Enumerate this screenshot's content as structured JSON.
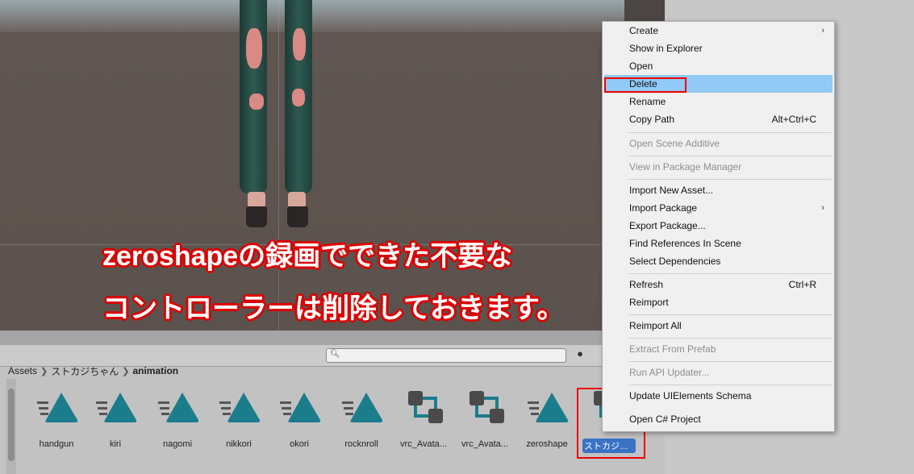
{
  "annotation": {
    "line1": "zeroshapeの録画でできた不要な",
    "line2": "コントローラーは削除しておきます。"
  },
  "breadcrumb": {
    "items": [
      "Assets",
      "ストカジちゃん",
      "animation"
    ]
  },
  "assets": [
    {
      "label": "handgun",
      "type": "anim"
    },
    {
      "label": "kiri",
      "type": "anim"
    },
    {
      "label": "nagomi",
      "type": "anim"
    },
    {
      "label": "nikkori",
      "type": "anim"
    },
    {
      "label": "okori",
      "type": "anim"
    },
    {
      "label": "rocknroll",
      "type": "anim"
    },
    {
      "label": "vrc_Avata...",
      "type": "controller"
    },
    {
      "label": "vrc_Avata...",
      "type": "controller"
    },
    {
      "label": "zeroshape",
      "type": "anim"
    },
    {
      "label": "ストカジちゃ...",
      "type": "controller",
      "selected": true
    }
  ],
  "context_menu": {
    "items": [
      {
        "label": "Create",
        "submenu": true
      },
      {
        "label": "Show in Explorer"
      },
      {
        "label": "Open"
      },
      {
        "label": "Delete",
        "highlighted": true
      },
      {
        "label": "Rename"
      },
      {
        "label": "Copy Path",
        "shortcut": "Alt+Ctrl+C"
      },
      {
        "label": "Open Scene Additive",
        "disabled": true
      },
      {
        "label": "View in Package Manager",
        "disabled": true
      },
      {
        "label": "Import New Asset..."
      },
      {
        "label": "Import Package",
        "submenu": true
      },
      {
        "label": "Export Package..."
      },
      {
        "label": "Find References In Scene"
      },
      {
        "label": "Select Dependencies"
      },
      {
        "label": "Refresh",
        "shortcut": "Ctrl+R"
      },
      {
        "label": "Reimport"
      },
      {
        "label": "Reimport All"
      },
      {
        "label": "Extract From Prefab",
        "disabled": true
      },
      {
        "label": "Run API Updater...",
        "disabled": true
      },
      {
        "label": "Update UIElements Schema"
      },
      {
        "label": "Open C# Project"
      }
    ]
  },
  "icons": {
    "anim": "animation-clip-icon",
    "controller": "animator-controller-icon",
    "search": "search-icon",
    "submenu": "chevron-right-icon"
  },
  "colors": {
    "anim_teal": "#1b7c8c",
    "controller_dark": "#4a4a4a",
    "controller_teal": "#1b7c8c",
    "highlight": "#91c9f7",
    "annotation_red": "#dd0000",
    "selection_blue": "#3a72c4"
  }
}
